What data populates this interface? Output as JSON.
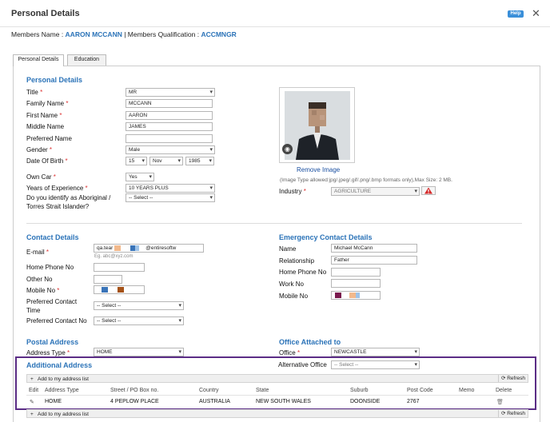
{
  "dialog": {
    "title": "Personal Details",
    "help_label": "Help",
    "close_glyph": "✕"
  },
  "members": {
    "name_label": "Members Name : ",
    "name": "AARON MCCANN",
    "sep": " | Members Qualification : ",
    "qualification": "ACCMNGR"
  },
  "tabs": [
    {
      "label": "Personal Details"
    },
    {
      "label": "Education"
    }
  ],
  "personal": {
    "heading": "Personal Details",
    "title": {
      "label": "Title",
      "value": "MR"
    },
    "family_name": {
      "label": "Family Name",
      "value": "MCCANN"
    },
    "first_name": {
      "label": "First Name",
      "value": "AARON"
    },
    "middle_name": {
      "label": "Middle Name",
      "value": "JAMES"
    },
    "preferred_name": {
      "label": "Preferred Name",
      "value": ""
    },
    "gender": {
      "label": "Gender",
      "value": "Male"
    },
    "dob": {
      "label": "Date Of Birth",
      "day": "15",
      "month": "Nov",
      "year": "1985"
    },
    "own_car": {
      "label": "Own Car",
      "value": "Yes"
    },
    "experience": {
      "label": "Years of Experience",
      "value": "10 YEARS PLUS"
    },
    "aboriginal": {
      "label1": "Do you identify as Aboriginal /",
      "label2": "Torres Strait Islander?",
      "value": "-- Select --"
    },
    "remove_image": "Remove Image",
    "image_note": "(Image Type allowed:jpg/.jpeg/.gif/.png/.bmp formats only),Max Size: 2 MB.",
    "industry": {
      "label": "Industry",
      "value": "AGRICULTURE"
    }
  },
  "contact": {
    "heading": "Contact Details",
    "email": {
      "label": "E-mail",
      "value_start": "qa.tear",
      "value_end": "@entiresoftw",
      "placeholder": "Eg. abc@xyz.com"
    },
    "home_phone": {
      "label": "Home Phone No"
    },
    "other_no": {
      "label": "Other No"
    },
    "mobile_no": {
      "label": "Mobile No"
    },
    "pref_contact_time": {
      "label1": "Preferred Contact",
      "label2": "Time",
      "value": "-- Select --"
    },
    "pref_contact_no": {
      "label": "Preferred Contact No",
      "value": "-- Select --"
    }
  },
  "emergency": {
    "heading": "Emergency Contact Details",
    "name": {
      "label": "Name",
      "value": "Michael McCann"
    },
    "relationship": {
      "label": "Relationship",
      "value": "Father"
    },
    "home_phone": {
      "label": "Home Phone No"
    },
    "work_no": {
      "label": "Work No"
    },
    "mobile_no": {
      "label": "Mobile No"
    }
  },
  "postal": {
    "heading": "Postal Address",
    "type_label": "Address Type",
    "type_value": "HOME"
  },
  "office": {
    "heading": "Office Attached to",
    "office_label": "Office",
    "office_value": "NEWCASTLE",
    "alt_label": "Alternative Office",
    "alt_value": "-- Select --"
  },
  "additional": {
    "heading": "Additional Address",
    "add_label": "Add to my address list",
    "refresh_label": "Refresh",
    "columns": [
      "Edit",
      "Address Type",
      "Street / PO Box no.",
      "Country",
      "State",
      "Suburb",
      "Post Code",
      "Memo",
      "Delete"
    ],
    "row": {
      "address_type": "HOME",
      "street": "4 PEPLOW PLACE",
      "country": "AUSTRALIA",
      "state": "NEW SOUTH WALES",
      "suburb": "DOONSIDE",
      "post_code": "2767",
      "memo": ""
    }
  },
  "colors": {
    "accent": "#2b73b8",
    "highlight_border": "#5b2d86",
    "required": "#d33333"
  }
}
